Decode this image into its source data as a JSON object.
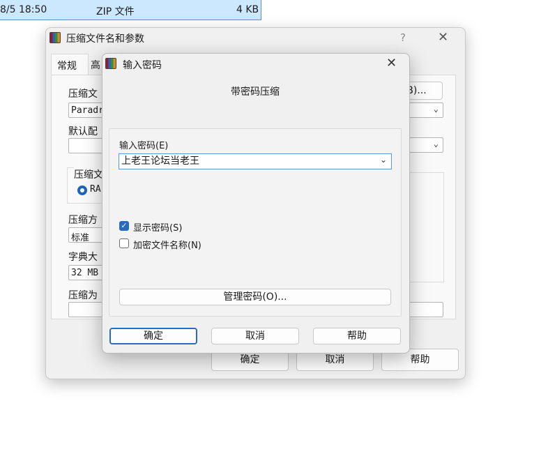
{
  "file_row": {
    "date": "8/5 18:50",
    "type": "ZIP 文件",
    "size": "4 KB"
  },
  "back_window": {
    "title": "压缩文件名和参数",
    "help": "?",
    "close": "✕",
    "tabs": [
      "常规",
      "高"
    ],
    "archive_label": "压缩文",
    "archive_value": "Paradr",
    "browse_button": "B)...",
    "profile_label": "默认配",
    "format_label": "压缩文",
    "format_option": "RA",
    "method_label": "压缩方",
    "method_value": "标准",
    "dict_label": "字典大",
    "dict_value": "32 MB",
    "split_label": "压缩为",
    "buttons": {
      "ok": "确定",
      "cancel": "取消",
      "help": "帮助"
    }
  },
  "dialog": {
    "title": "输入密码",
    "close": "✕",
    "heading": "带密码压缩",
    "password_label": "输入密码(E)",
    "password_value": "上老王论坛当老王",
    "show_password": {
      "label": "显示密码(S)",
      "checked": true
    },
    "encrypt_names": {
      "label": "加密文件名称(N)",
      "checked": false
    },
    "manage_button": "管理密码(O)...",
    "buttons": {
      "ok": "确定",
      "cancel": "取消",
      "help": "帮助"
    }
  },
  "colors": {
    "accent": "#2a6bc2",
    "selection": "#cce8ff"
  }
}
